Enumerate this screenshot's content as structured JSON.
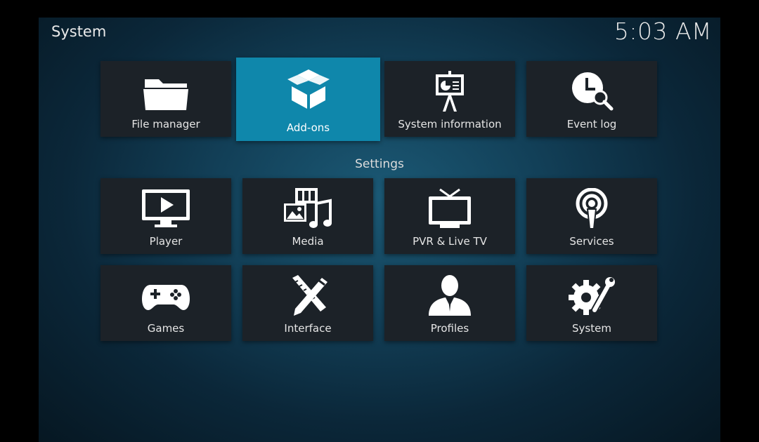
{
  "header": {
    "title": "System",
    "clock": "5:03 AM"
  },
  "top_row": [
    {
      "label": "File manager",
      "icon": "folder-icon"
    },
    {
      "label": "Add-ons",
      "icon": "open-box-icon",
      "focused": true
    },
    {
      "label": "System information",
      "icon": "presentation-board-icon"
    },
    {
      "label": "Event log",
      "icon": "clock-search-icon"
    }
  ],
  "settings": {
    "title": "Settings",
    "row1": [
      {
        "label": "Player",
        "icon": "monitor-play-icon"
      },
      {
        "label": "Media",
        "icon": "media-collage-icon"
      },
      {
        "label": "PVR & Live TV",
        "icon": "tv-antenna-icon"
      },
      {
        "label": "Services",
        "icon": "broadcast-icon"
      }
    ],
    "row2": [
      {
        "label": "Games",
        "icon": "gamepad-icon"
      },
      {
        "label": "Interface",
        "icon": "pencil-ruler-icon"
      },
      {
        "label": "Profiles",
        "icon": "user-silhouette-icon"
      },
      {
        "label": "System",
        "icon": "gear-wrench-icon"
      }
    ]
  },
  "colors": {
    "focus": "#0f87ab",
    "tile": "#1c2228",
    "background": "#123f57"
  }
}
